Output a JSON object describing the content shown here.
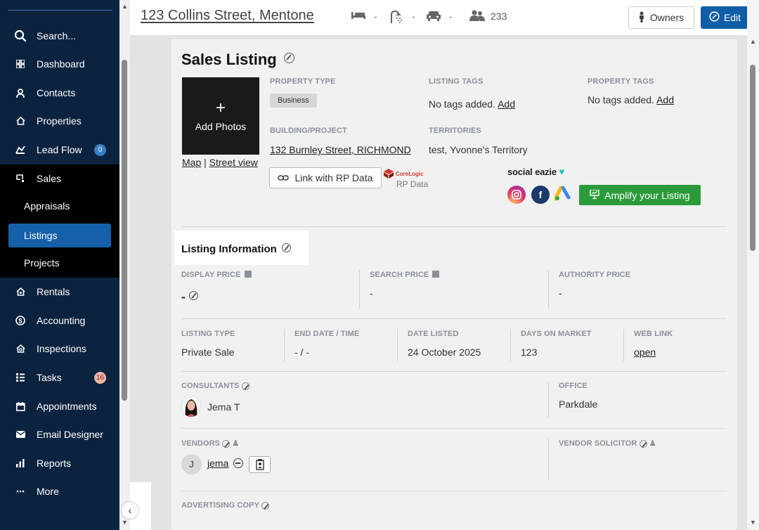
{
  "sidebar": {
    "search": "Search...",
    "items": [
      {
        "label": "Dashboard",
        "icon": "grid-icon"
      },
      {
        "label": "Contacts",
        "icon": "person-icon"
      },
      {
        "label": "Properties",
        "icon": "house-icon"
      },
      {
        "label": "Lead Flow",
        "icon": "lead-flow-icon",
        "badge": "0"
      },
      {
        "label": "Sales",
        "icon": "sales-icon"
      },
      {
        "label": "Rentals",
        "icon": "rentals-icon"
      },
      {
        "label": "Accounting",
        "icon": "dollar-icon"
      },
      {
        "label": "Inspections",
        "icon": "inspections-icon"
      },
      {
        "label": "Tasks",
        "icon": "tasks-icon",
        "badge": "16"
      },
      {
        "label": "Appointments",
        "icon": "calendar-icon"
      },
      {
        "label": "Email Designer",
        "icon": "envelope-icon"
      },
      {
        "label": "Reports",
        "icon": "bar-chart-icon"
      },
      {
        "label": "More",
        "icon": "ellipsis-icon"
      }
    ],
    "sales_sub": [
      "Appraisals",
      "Listings",
      "Projects"
    ]
  },
  "header": {
    "address": "123 Collins Street, Mentone",
    "bed": "-",
    "bath": "-",
    "car": "-",
    "people_count": "233",
    "owners_label": "Owners",
    "edit_label": "Edit"
  },
  "listing": {
    "title": "Sales Listing",
    "add_photos": "Add Photos",
    "plus": "+",
    "map_link": "Map",
    "sep": "|",
    "street_view_link": "Street view",
    "property_type_label": "PROPERTY TYPE",
    "property_type_value": "Business",
    "listing_tags_label": "LISTING TAGS",
    "listing_tags_value": "No tags added.",
    "property_tags_label": "PROPERTY TAGS",
    "property_tags_value": "No tags added.",
    "add_link": "Add",
    "building_label": "BUILDING/PROJECT",
    "building_value": "132 Burnley Street, RICHMOND",
    "territories_label": "TERRITORIES",
    "territories_value": "test, Yvonne's Territory",
    "rp_button": "Link with RP Data",
    "corelogic": "CoreLogic",
    "rp_data": "RP Data",
    "social_eazie": "social eazie",
    "amplify_button": "Amplify your Listing"
  },
  "info": {
    "title": "Listing Information",
    "display_price_label": "DISPLAY PRICE",
    "display_price_value": "-",
    "search_price_label": "SEARCH PRICE",
    "search_price_value": "-",
    "authority_price_label": "AUTHORITY PRICE",
    "authority_price_value": "-",
    "listing_type_label": "LISTING TYPE",
    "listing_type_value": "Private Sale",
    "end_date_label": "END DATE / TIME",
    "end_date_value": "- / -",
    "date_listed_label": "DATE LISTED",
    "date_listed_value": "24 October 2025",
    "days_on_market_label": "DAYS ON MARKET",
    "days_on_market_value": "123",
    "web_link_label": "WEB LINK",
    "web_link_value": "open",
    "consultants_label": "CONSULTANTS",
    "consultant_name": "Jema T",
    "office_label": "OFFICE",
    "office_value": "Parkdale",
    "vendors_label": "VENDORS",
    "vendor_initial": "J",
    "vendor_name": "jema",
    "vendor_solicitor_label": "VENDOR SOLICITOR",
    "advertising_copy_label": "ADVERTISING COPY"
  }
}
